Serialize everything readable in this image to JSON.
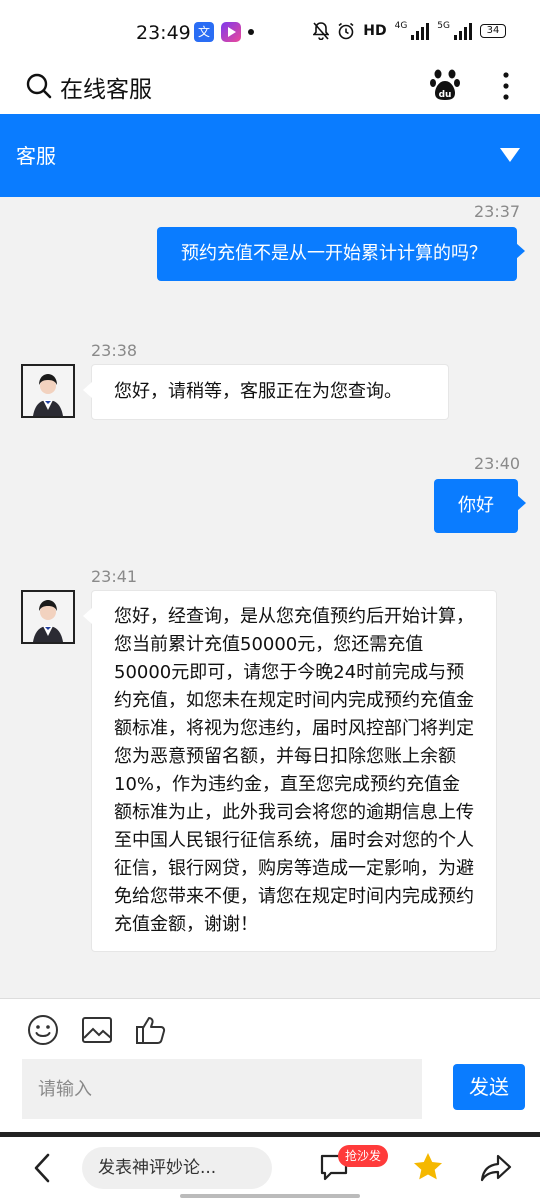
{
  "status_bar": {
    "time": "23:49",
    "app1_glyph": "文",
    "indicators": "HD",
    "network_1": "4G",
    "network_2": "5G",
    "battery": "34"
  },
  "app_bar": {
    "title": "在线客服",
    "icons": [
      "search-icon",
      "baidu-paw-icon",
      "more-vertical-icon"
    ]
  },
  "chat_header": {
    "title": "客服",
    "icon": "caret-down-icon"
  },
  "messages": [
    {
      "role": "user",
      "time": "23:37",
      "text": "预约充值不是从一开始累计计算的吗？"
    },
    {
      "role": "agent",
      "time": "23:38",
      "text": "您好，请稍等，客服正在为您查询。"
    },
    {
      "role": "user",
      "time": "23:40",
      "text": "你好"
    },
    {
      "role": "agent",
      "time": "23:41",
      "text": "您好，经查询，是从您充值预约后开始计算，您当前累计充值50000元，您还需充值50000元即可，请您于今晚24时前完成与预约充值，如您未在规定时间内完成预约充值金额标准，将视为您违约，届时风控部门将判定您为恶意预留名额，并每日扣除您账上余额10%，作为违约金，直至您完成预约充值金额标准为止，此外我司会将您的逾期信息上传至中国人民银行征信系统，届时会对您的个人征信，银行网贷，购房等造成一定影响，为避免给您带来不便，请您在规定时间内完成预约充值金额，谢谢！"
    }
  ],
  "composer": {
    "tools": [
      "emoji-icon",
      "image-icon",
      "thumbs-up-icon"
    ],
    "placeholder": "请输入",
    "send_label": "发送"
  },
  "bottom_nav": {
    "comment_placeholder": "发表神评妙论...",
    "badge": "抢沙发",
    "icons": [
      "back-icon",
      "comment-icon",
      "star-icon",
      "share-icon"
    ]
  },
  "colors": {
    "accent": "#0a7cff",
    "star": "#f5b800",
    "badge": "#ff3b3b"
  }
}
